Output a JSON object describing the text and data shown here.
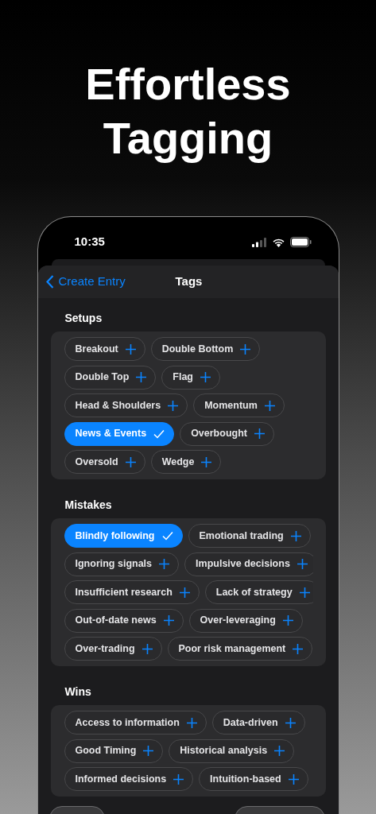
{
  "headline": [
    "Effortless",
    "Tagging"
  ],
  "status_bar": {
    "time": "10:35"
  },
  "nav": {
    "back": "Create Entry",
    "title": "Tags"
  },
  "sections": [
    {
      "title": "Setups",
      "scrolls": false,
      "rows": [
        [
          {
            "label": "Breakout",
            "selected": false
          },
          {
            "label": "Double Bottom",
            "selected": false
          }
        ],
        [
          {
            "label": "Double Top",
            "selected": false
          },
          {
            "label": "Flag",
            "selected": false
          }
        ],
        [
          {
            "label": "Head & Shoulders",
            "selected": false
          },
          {
            "label": "Momentum",
            "selected": false
          }
        ],
        [
          {
            "label": "News & Events",
            "selected": true
          },
          {
            "label": "Overbought",
            "selected": false
          }
        ],
        [
          {
            "label": "Oversold",
            "selected": false
          },
          {
            "label": "Wedge",
            "selected": false
          }
        ]
      ]
    },
    {
      "title": "Mistakes",
      "scrolls": true,
      "rows": [
        [
          {
            "label": "Blindly following",
            "selected": true
          },
          {
            "label": "Emotional trading",
            "selected": false
          }
        ],
        [
          {
            "label": "Ignoring signals",
            "selected": false
          },
          {
            "label": "Impulsive decisions",
            "selected": false
          }
        ],
        [
          {
            "label": "Insufficient research",
            "selected": false
          },
          {
            "label": "Lack of strategy",
            "selected": false
          }
        ],
        [
          {
            "label": "Out-of-date news",
            "selected": false
          },
          {
            "label": "Over-leveraging",
            "selected": false
          }
        ],
        [
          {
            "label": "Over-trading",
            "selected": false
          },
          {
            "label": "Poor risk management",
            "selected": false
          }
        ]
      ]
    },
    {
      "title": "Wins",
      "scrolls": true,
      "rows": [
        [
          {
            "label": "Access to information",
            "selected": false
          },
          {
            "label": "Data-driven",
            "selected": false
          }
        ],
        [
          {
            "label": "Good Timing",
            "selected": false
          },
          {
            "label": "Historical analysis",
            "selected": false
          }
        ],
        [
          {
            "label": "Informed decisions",
            "selected": false
          },
          {
            "label": "Intuition-based",
            "selected": false
          }
        ]
      ]
    }
  ]
}
